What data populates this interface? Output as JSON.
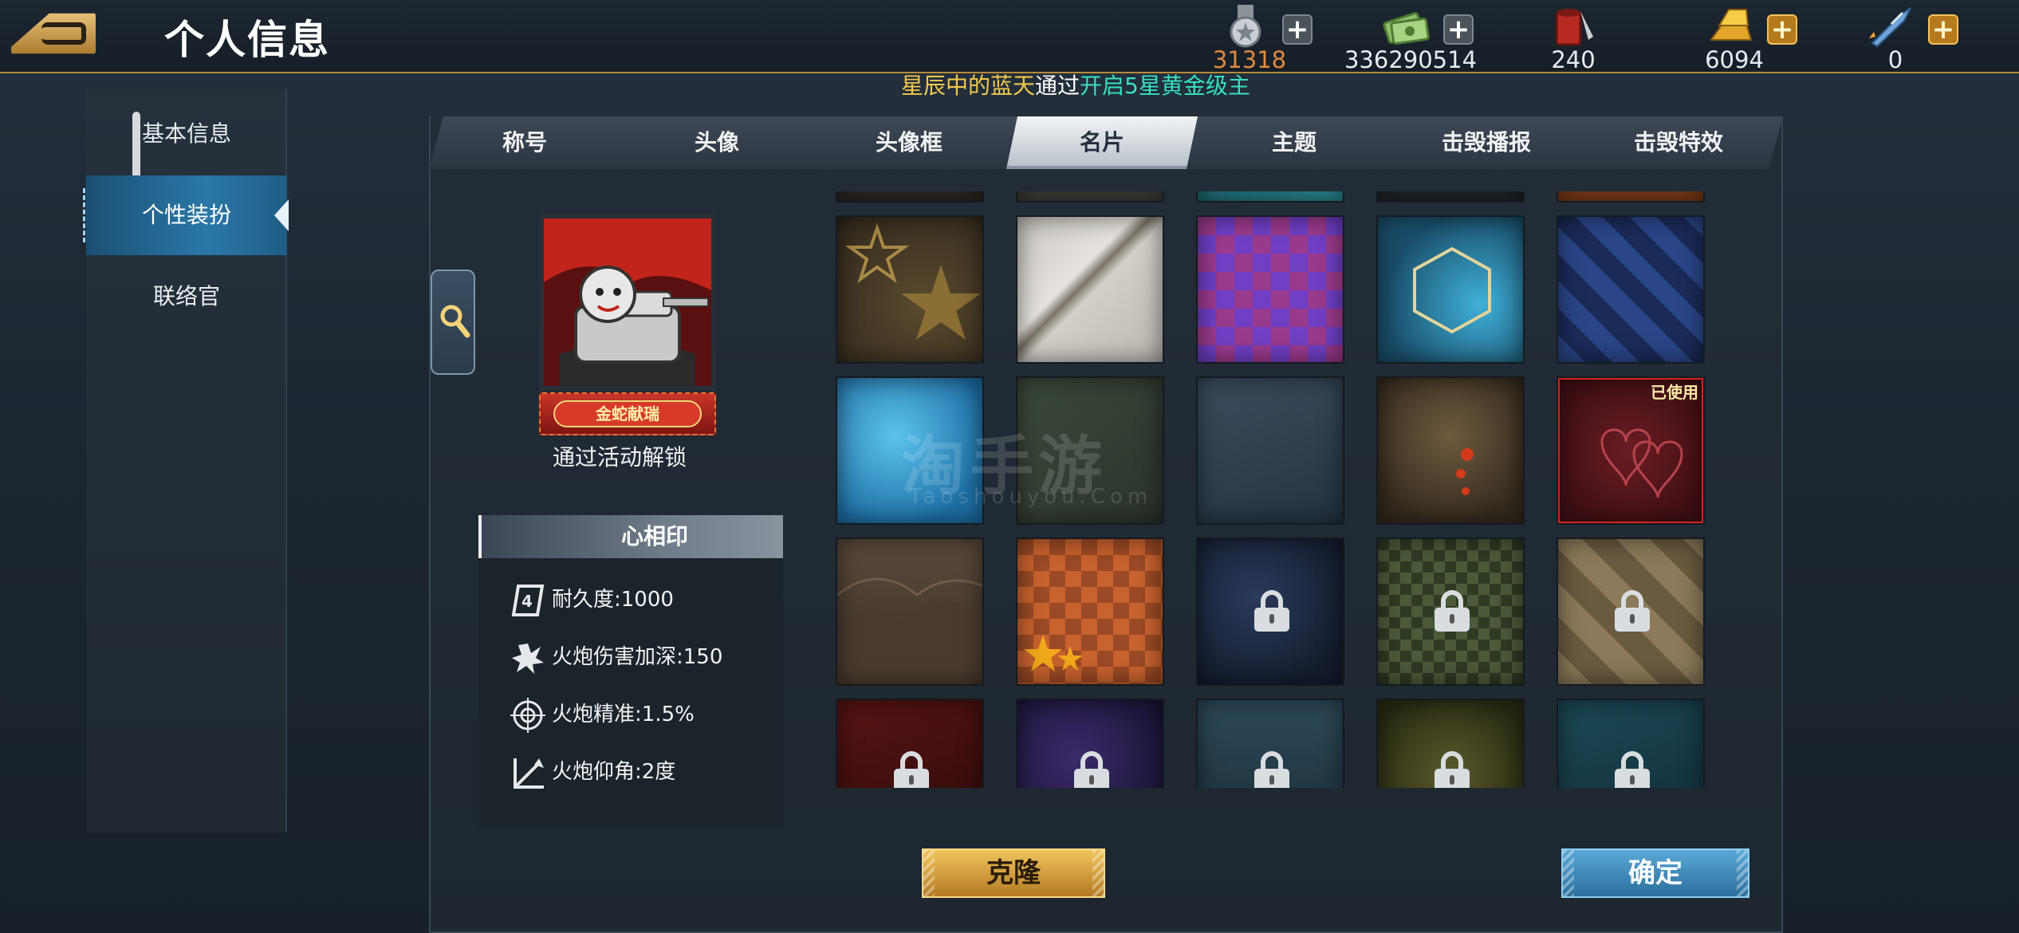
{
  "header": {
    "title": "个人信息",
    "resources": [
      {
        "name": "medal",
        "value": "31318",
        "color": "#e08a3c",
        "plus": "grey"
      },
      {
        "name": "cash",
        "value": "336290514",
        "color": "#ffffff",
        "plus": "grey"
      },
      {
        "name": "paint-bucket",
        "value": "240",
        "color": "#ffffff",
        "plus": "none"
      },
      {
        "name": "gold-bars",
        "value": "6094",
        "color": "#ffffff",
        "plus": "gold"
      },
      {
        "name": "rocket",
        "value": "0",
        "color": "#ffffff",
        "plus": "gold"
      }
    ],
    "marquee": {
      "part1": "星辰中的蓝天",
      "part2": "通过",
      "part3": "开启5星黄金级主"
    }
  },
  "sidebar": {
    "items": [
      {
        "label": "基本信息",
        "active": false
      },
      {
        "label": "个性装扮",
        "active": true
      },
      {
        "label": "联络官",
        "active": false
      }
    ]
  },
  "tabs": [
    {
      "label": "称号",
      "active": false
    },
    {
      "label": "头像",
      "active": false
    },
    {
      "label": "头像框",
      "active": false
    },
    {
      "label": "名片",
      "active": true
    },
    {
      "label": "主题",
      "active": false
    },
    {
      "label": "击毁播报",
      "active": false
    },
    {
      "label": "击毁特效",
      "active": false
    }
  ],
  "preview": {
    "badge_text": "金蛇献瑞",
    "unlock_text": "通过活动解锁"
  },
  "stats": {
    "title": "心相印",
    "rows": [
      {
        "icon": "durability-icon",
        "text": "耐久度:1000"
      },
      {
        "icon": "explosion-icon",
        "text": "火炮伤害加深:150"
      },
      {
        "icon": "crosshair-icon",
        "text": "火炮精准:1.5%"
      },
      {
        "icon": "elevation-angle-icon",
        "text": "火炮仰角:2度"
      }
    ]
  },
  "cards": {
    "used_label": "已使用",
    "watermark": "淘手游",
    "watermark_sub": "Taoshouyou.Com"
  },
  "buttons": {
    "clone": "克隆",
    "confirm": "确定"
  },
  "colors": {
    "accent_gold": "#b58a3a",
    "active_blue": "#2a78a8",
    "used_red": "#d5241c"
  }
}
